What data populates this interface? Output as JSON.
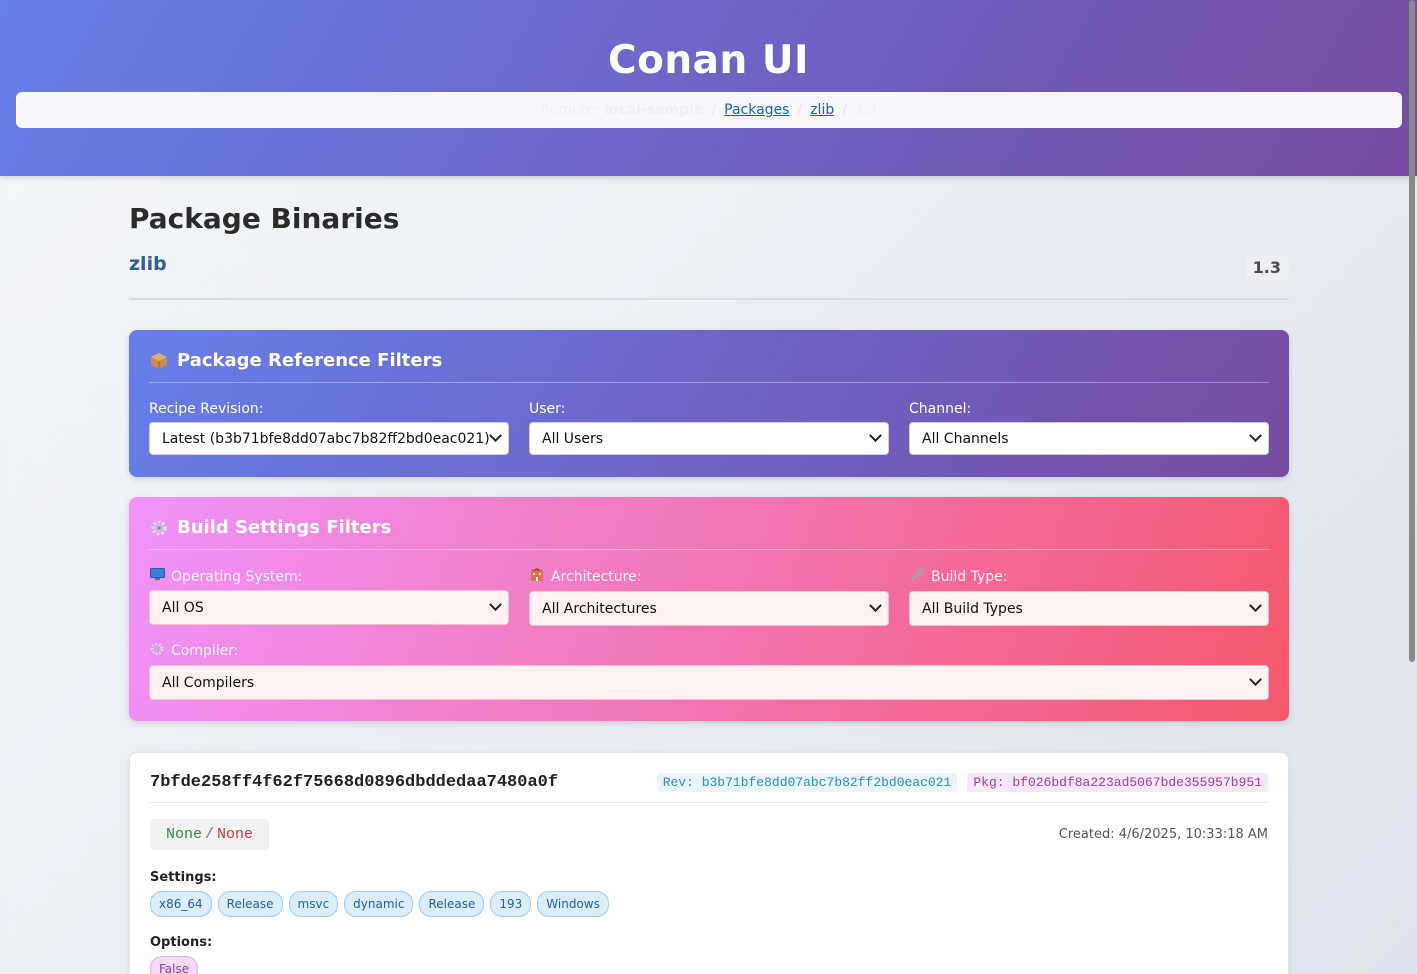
{
  "app": {
    "title": "Conan UI"
  },
  "breadcrumb": {
    "remote_prefix": "Remote:",
    "remote_name": "local-sample",
    "packages": "Packages",
    "package": "zlib",
    "version": "1.3",
    "separator": "/"
  },
  "page": {
    "title": "Package Binaries",
    "package_name": "zlib",
    "version": "1.3"
  },
  "ref_filters": {
    "title": "Package Reference Filters",
    "icon": "package-icon",
    "recipe_revision": {
      "label": "Recipe Revision:",
      "value": "Latest (b3b71bfe8dd07abc7b82ff2bd0eac021)"
    },
    "user": {
      "label": "User:",
      "value": "All Users"
    },
    "channel": {
      "label": "Channel:",
      "value": "All Channels"
    }
  },
  "build_filters": {
    "title": "Build Settings Filters",
    "icon": "gear-icon",
    "os": {
      "label": "Operating System:",
      "value": "All OS",
      "icon": "monitor-icon"
    },
    "arch": {
      "label": "Architecture:",
      "value": "All Architectures",
      "icon": "building-icon"
    },
    "build_type": {
      "label": "Build Type:",
      "value": "All Build Types",
      "icon": "wrench-icon"
    },
    "compiler": {
      "label": "Compiler:",
      "value": "All Compilers",
      "icon": "gear-icon"
    }
  },
  "binaries": [
    {
      "package_id": "7bfde258ff4f62f75668d0896dbddedaa7480a0f",
      "rev": "Rev: b3b71bfe8dd07abc7b82ff2bd0eac021",
      "pkg": "Pkg: bf026bdf8a223ad5067bde355957b951",
      "status_a": "None",
      "status_sep": "/",
      "status_b": "None",
      "created": "Created: 4/6/2025, 10:33:18 AM",
      "settings_label": "Settings:",
      "settings": [
        "x86_64",
        "Release",
        "msvc",
        "dynamic",
        "Release",
        "193",
        "Windows"
      ],
      "options_label": "Options:",
      "options": [
        "False"
      ]
    }
  ],
  "colors": {
    "header_gradient_start": "#667eea",
    "header_gradient_end": "#764ba2",
    "build_gradient_start": "#f093fb",
    "build_gradient_end": "#f5576c",
    "link": "#0a66c8"
  }
}
